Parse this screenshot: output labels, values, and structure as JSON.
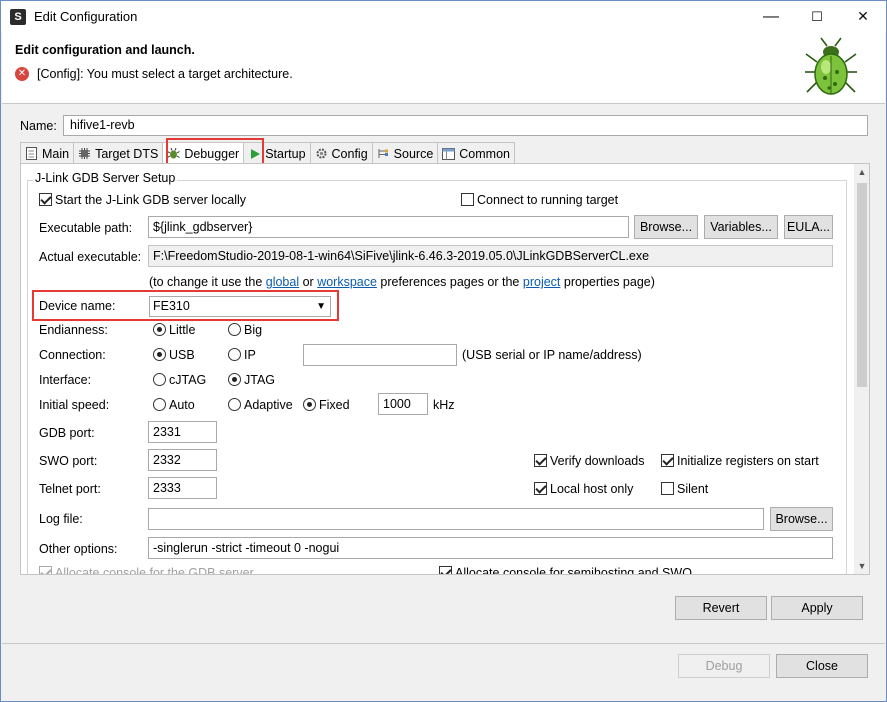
{
  "window": {
    "title": "Edit Configuration",
    "controls": {
      "minimize": "—",
      "maximize": "☐",
      "close": "✕"
    }
  },
  "header": {
    "heading": "Edit configuration and launch.",
    "error_message": "[Config]: You must select a target architecture."
  },
  "name": {
    "label": "Name:",
    "value": "hifive1-revb"
  },
  "tabs": [
    {
      "label": "Main",
      "icon": "main-tab-icon"
    },
    {
      "label": "Target DTS",
      "icon": "target-dts-icon"
    },
    {
      "label": "Debugger",
      "icon": "debugger-icon",
      "active": true
    },
    {
      "label": "Startup",
      "icon": "startup-play-icon"
    },
    {
      "label": "Config",
      "icon": "config-gear-icon"
    },
    {
      "label": "Source",
      "icon": "source-icon"
    },
    {
      "label": "Common",
      "icon": "common-icon"
    }
  ],
  "debugger": {
    "group_title": "J-Link GDB Server Setup",
    "start_server_label": "Start the J-Link GDB server locally",
    "start_server_checked": true,
    "connect_running_label": "Connect to running target",
    "connect_running_checked": false,
    "executable_label": "Executable path:",
    "executable_value": "${jlink_gdbserver}",
    "browse_label": "Browse...",
    "variables_label": "Variables...",
    "eula_label": "EULA...",
    "actual_label": "Actual executable:",
    "actual_value": "F:\\FreedomStudio-2019-08-1-win64\\SiFive\\jlink-6.46.3-2019.05.0\\JLinkGDBServerCL.exe",
    "hint_prefix": "(to change it use the ",
    "hint_global": "global",
    "hint_or": " or ",
    "hint_workspace": "workspace",
    "hint_mid": " preferences pages or the ",
    "hint_project": "project",
    "hint_suffix": " properties page)",
    "device_label": "Device name:",
    "device_value": "FE310",
    "endianness_label": "Endianness:",
    "endian_little": "Little",
    "endian_big": "Big",
    "connection_label": "Connection:",
    "conn_usb": "USB",
    "conn_ip": "IP",
    "conn_value": "",
    "conn_hint": "(USB serial or IP name/address)",
    "interface_label": "Interface:",
    "if_cjtag": "cJTAG",
    "if_jtag": "JTAG",
    "speed_label": "Initial speed:",
    "speed_auto": "Auto",
    "speed_adaptive": "Adaptive",
    "speed_fixed": "Fixed",
    "speed_value": "1000",
    "speed_unit": "kHz",
    "gdb_port_label": "GDB port:",
    "gdb_port": "2331",
    "swo_port_label": "SWO port:",
    "swo_port": "2332",
    "telnet_port_label": "Telnet port:",
    "telnet_port": "2333",
    "verify_label": "Verify downloads",
    "init_regs_label": "Initialize registers on start",
    "local_host_label": "Local host only",
    "silent_label": "Silent",
    "log_label": "Log file:",
    "log_value": "",
    "log_browse_label": "Browse...",
    "other_label": "Other options:",
    "other_value": "-singlerun -strict -timeout 0 -nogui",
    "alloc_gdb_label": "Allocate console for the GDB server",
    "alloc_semi_label": "Allocate console for semihosting and SWO"
  },
  "footer": {
    "revert_label": "Revert",
    "apply_label": "Apply",
    "debug_label": "Debug",
    "close_label": "Close"
  },
  "colors": {
    "highlight": "#e53935",
    "link": "#0b5cad",
    "error": "#d9453f"
  }
}
